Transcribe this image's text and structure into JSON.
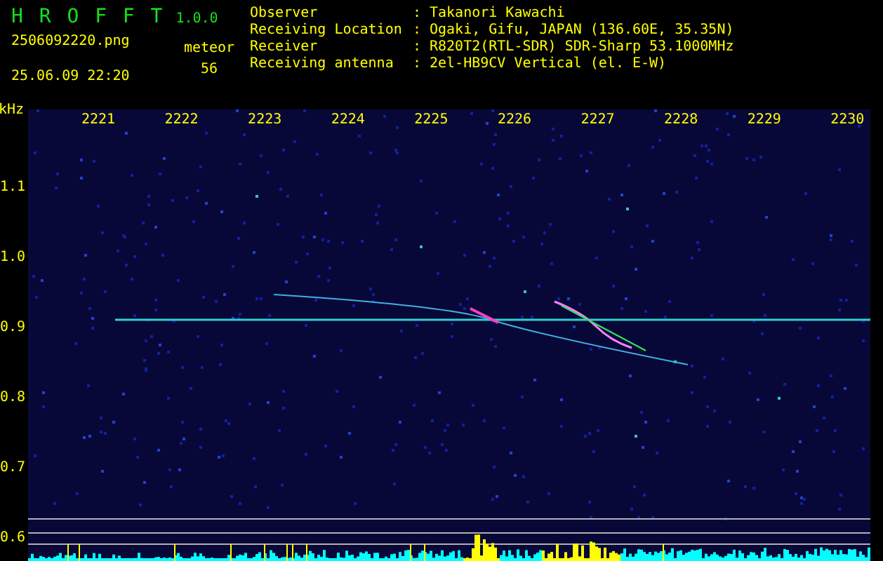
{
  "app": {
    "title": "H R O F F T",
    "version": "1.0.0",
    "filename": "2506092220.png",
    "timestamp": "25.06.09 22:20"
  },
  "counter": {
    "label": "meteor",
    "value": "56"
  },
  "station": [
    {
      "label": "Observer",
      "separator": ":",
      "value": "Takanori Kawachi"
    },
    {
      "label": "Receiving Location",
      "separator": ":",
      "value": "Ogaki, Gifu, JAPAN (136.60E, 35.35N)"
    },
    {
      "label": "Receiver",
      "separator": ":",
      "value": "R820T2(RTL-SDR) SDR-Sharp 53.1000MHz"
    },
    {
      "label": "Receiving antenna",
      "separator": ":",
      "value": "2el-HB9CV Vertical (el. E-W)"
    }
  ],
  "spectrogram": {
    "y_unit": "kHz",
    "y_labels": [
      "1.1",
      "1.0",
      "0.9",
      "0.8",
      "0.7",
      "0.6"
    ],
    "x_labels": [
      "2221",
      "2222",
      "2223",
      "2224",
      "2225",
      "2226",
      "2227",
      "2228",
      "2229",
      "2230"
    ]
  }
}
